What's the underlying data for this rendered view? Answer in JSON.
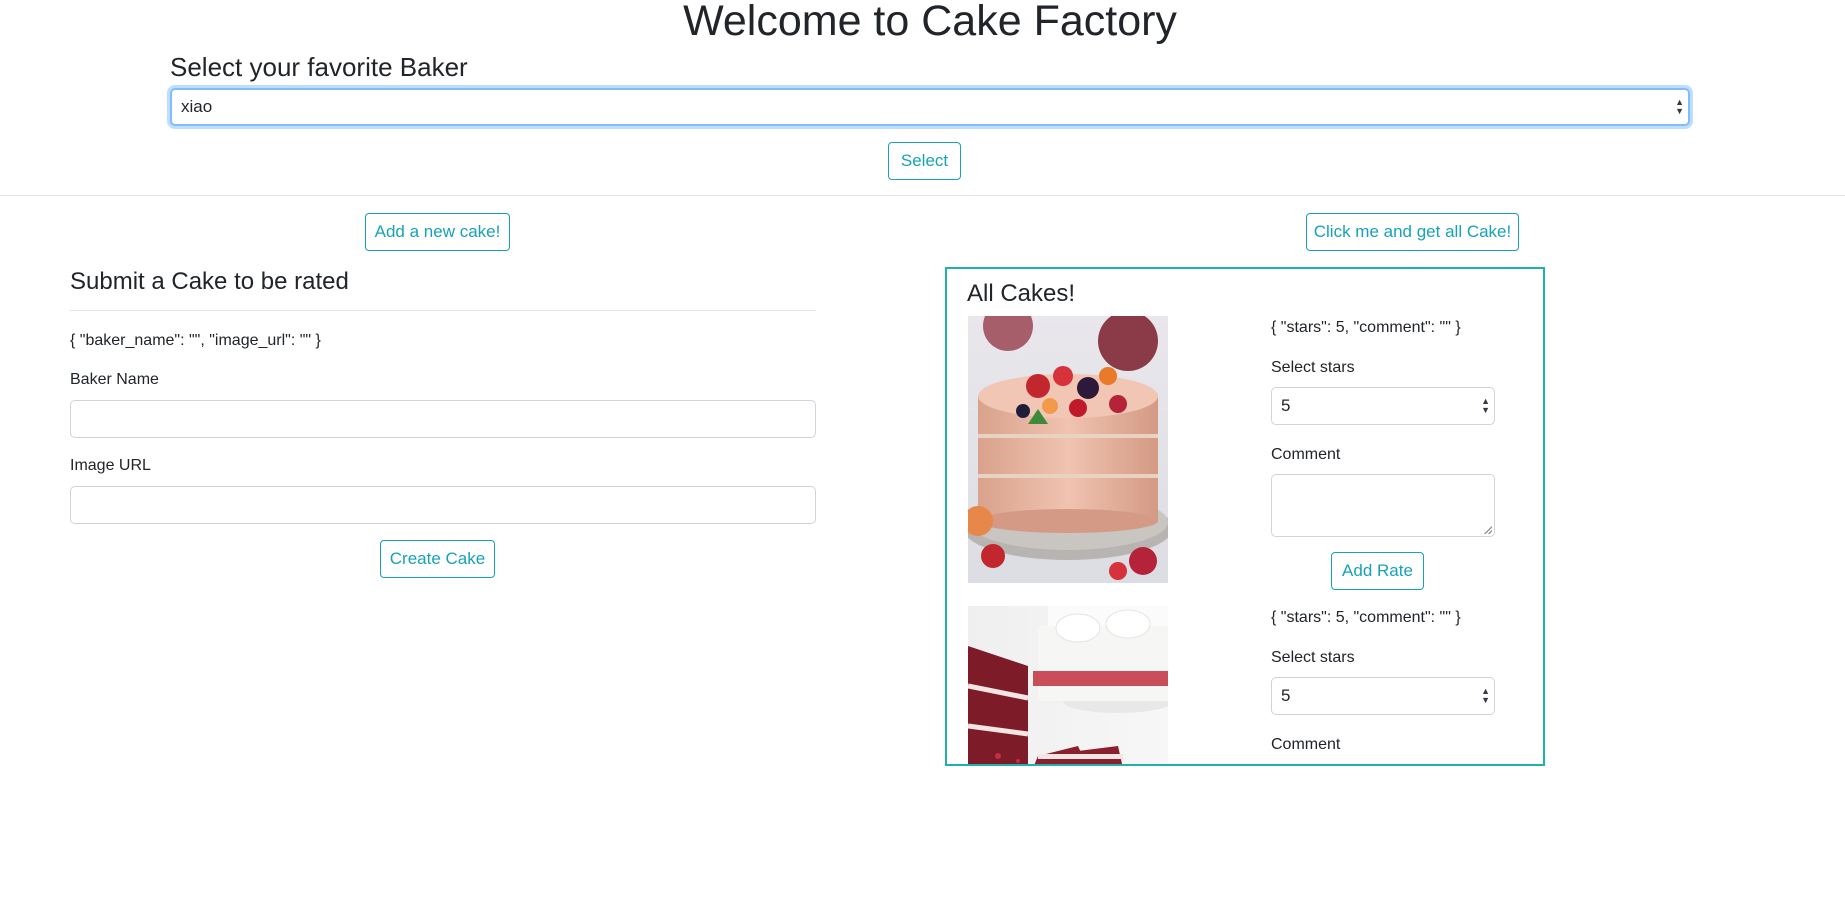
{
  "header": {
    "title": "Welcome to Cake Factory",
    "select_label": "Select your favorite Baker",
    "baker_value": "xiao",
    "select_button": "Select"
  },
  "left": {
    "add_button": "Add a new cake!",
    "form_title": "Submit a Cake to be rated",
    "form_state": "{ \"baker_name\": \"\", \"image_url\": \"\" }",
    "baker_name_label": "Baker Name",
    "baker_name_value": "",
    "image_url_label": "Image URL",
    "image_url_value": "",
    "create_button": "Create Cake"
  },
  "right": {
    "get_all_button": "Click me and get all Cake!",
    "panel_title": "All Cakes!",
    "cakes": [
      {
        "state": "{ \"stars\": 5, \"comment\": \"\" }",
        "stars_label": "Select stars",
        "stars_value": "5",
        "comment_label": "Comment",
        "comment_value": "",
        "add_rate_button": "Add Rate"
      },
      {
        "state": "{ \"stars\": 5, \"comment\": \"\" }",
        "stars_label": "Select stars",
        "stars_value": "5",
        "comment_label": "Comment"
      }
    ]
  },
  "colors": {
    "accent": "#17a2b8",
    "panel_border": "#20b2aa",
    "focus_border": "#80bdff"
  }
}
